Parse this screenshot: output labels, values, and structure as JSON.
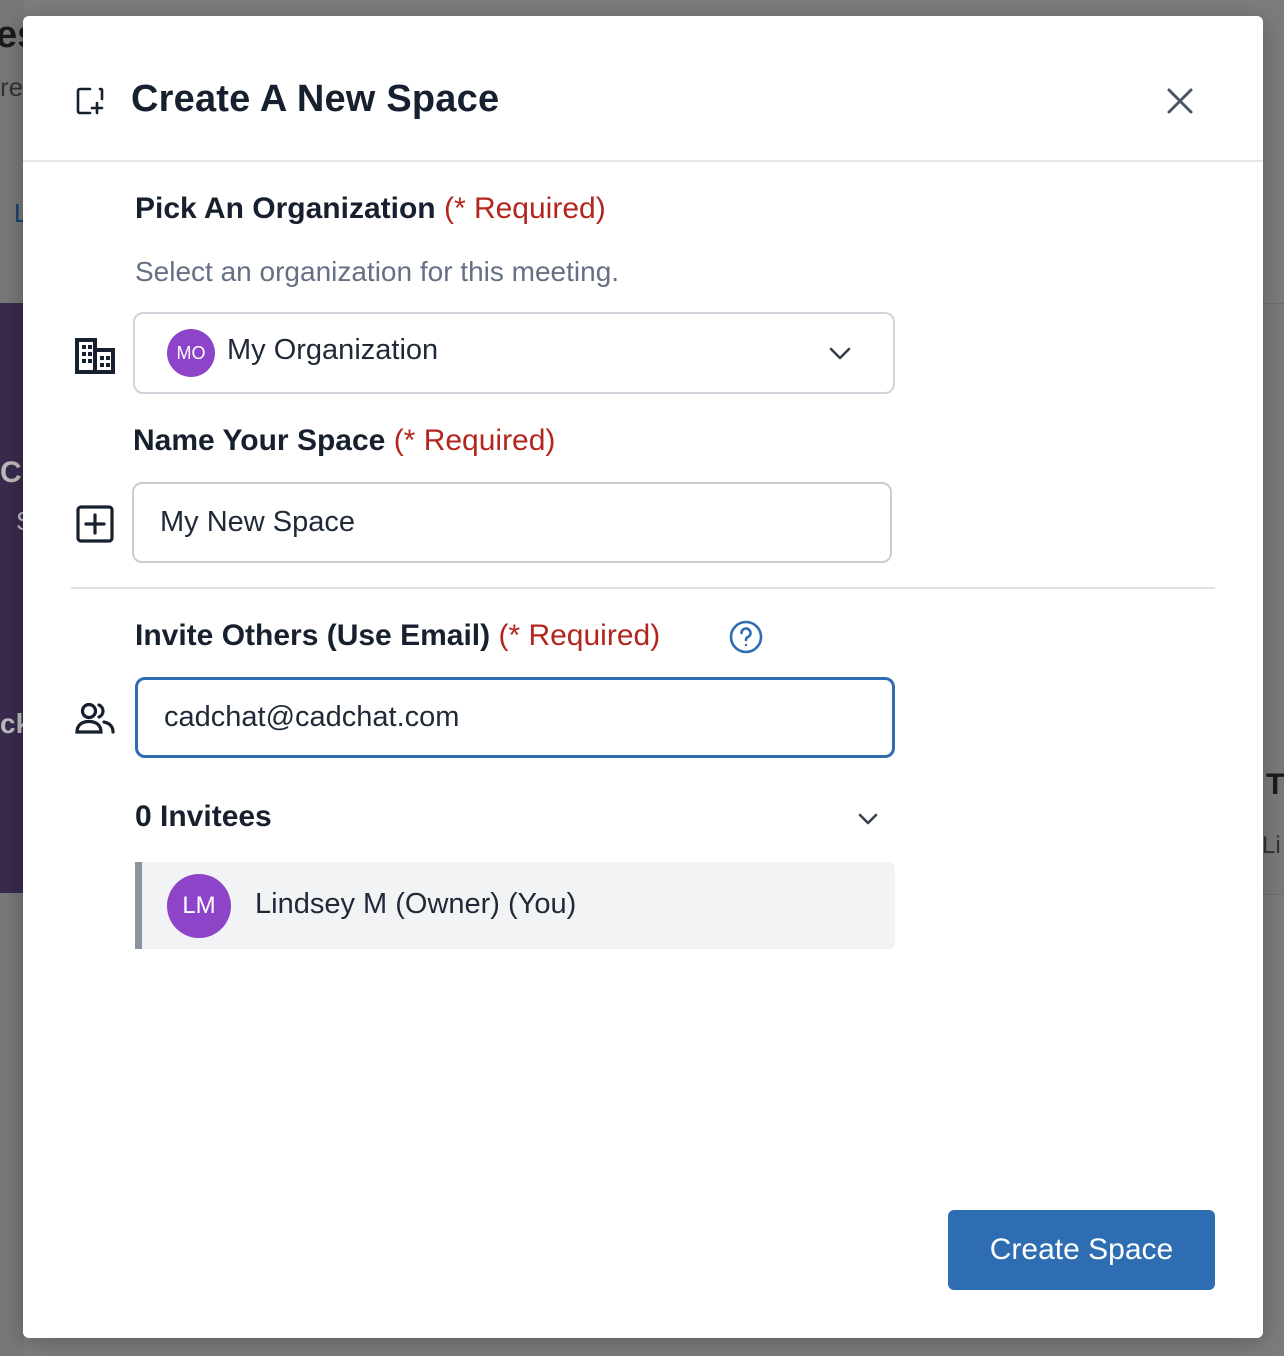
{
  "background": {
    "fragments": [
      "es",
      "re",
      "L",
      "C",
      "S",
      "ck",
      "T",
      "Li"
    ]
  },
  "modal": {
    "title": "Create A New Space",
    "organization": {
      "label": "Pick An Organization",
      "required": "(* Required)",
      "helper": "Select an organization for this meeting.",
      "selected_initials": "MO",
      "selected_value": "My Organization"
    },
    "space_name": {
      "label": "Name Your Space",
      "required": "(* Required)",
      "value": "My New Space"
    },
    "invite": {
      "label": "Invite Others (Use Email)",
      "required": "(* Required)",
      "email_value": "cadchat@cadchat.com"
    },
    "invitees": {
      "label": "0 Invitees",
      "items": [
        {
          "initials": "LM",
          "name": "Lindsey M (Owner) (You)"
        }
      ]
    },
    "create_button_label": "Create Space"
  },
  "colors": {
    "primary": "#2f6db3",
    "required": "#b3261e",
    "avatar": "#8e44c9"
  }
}
